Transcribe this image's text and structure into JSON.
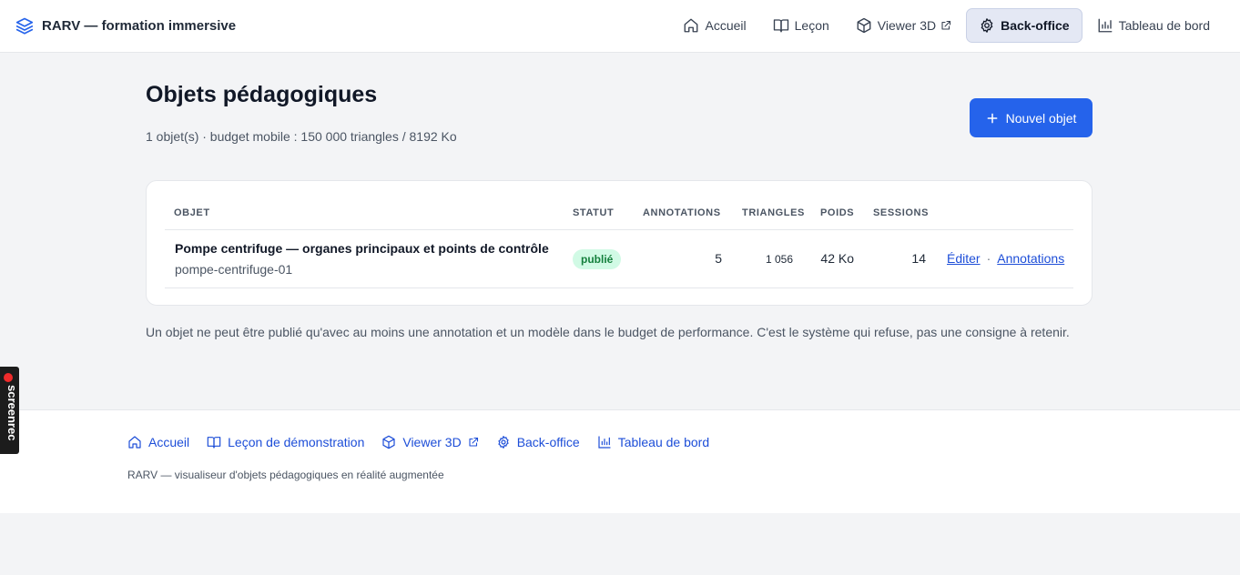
{
  "header": {
    "brand": "RARV — formation immersive",
    "nav": [
      {
        "label": "Accueil",
        "icon": "home-icon"
      },
      {
        "label": "Leçon",
        "icon": "book-icon"
      },
      {
        "label": "Viewer 3D",
        "icon": "cube-icon",
        "external": true
      },
      {
        "label": "Back-office",
        "icon": "gear-icon",
        "active": true
      },
      {
        "label": "Tableau de bord",
        "icon": "bar-chart-icon"
      }
    ]
  },
  "main": {
    "title": "Objets pédagogiques",
    "subtitle": "1 objet(s) · budget mobile : 150 000 triangles / 8192 Ko",
    "new_button": "Nouvel objet",
    "table": {
      "columns": [
        "Objet",
        "Statut",
        "Annotations",
        "Triangles",
        "Poids",
        "Sessions"
      ],
      "rows": [
        {
          "title": "Pompe centrifuge — organes principaux et points de contrôle",
          "slug": "pompe-centrifuge-01",
          "status": "publié",
          "annotations": "5",
          "triangles": "1 056",
          "weight": "42 Ko",
          "sessions": "14",
          "edit": "Éditer",
          "separator": "·",
          "annotations_link": "Annotations"
        }
      ]
    },
    "note": "Un objet ne peut être publié qu'avec au moins une annotation et un modèle dans le budget de performance. C'est le système qui refuse, pas une consigne à retenir."
  },
  "footer": {
    "links": [
      {
        "label": "Accueil",
        "icon": "home-icon"
      },
      {
        "label": "Leçon de démonstration",
        "icon": "book-icon"
      },
      {
        "label": "Viewer 3D",
        "icon": "cube-icon",
        "external": true
      },
      {
        "label": "Back-office",
        "icon": "gear-icon"
      },
      {
        "label": "Tableau de bord",
        "icon": "bar-chart-icon"
      }
    ],
    "tagline": "RARV — visualiseur d'objets pédagogiques en réalité augmentée"
  },
  "overlay": {
    "recorder": "screenrec"
  },
  "colors": {
    "accent": "#2563eb",
    "link": "#1d4ed8",
    "badge_bg": "#d1fae5",
    "badge_text": "#15803d"
  }
}
